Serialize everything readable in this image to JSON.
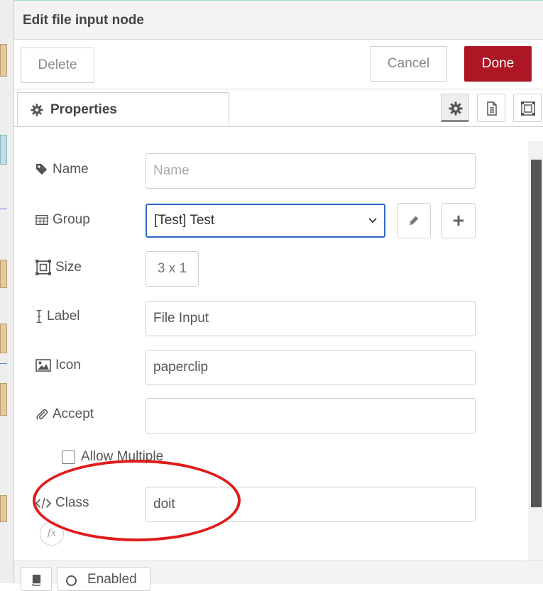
{
  "title": "Edit file input node",
  "buttons": {
    "delete": "Delete",
    "cancel": "Cancel",
    "done": "Done"
  },
  "tabs": {
    "properties": "Properties"
  },
  "fields": {
    "name": {
      "label": "Name",
      "placeholder": "Name",
      "value": ""
    },
    "group": {
      "label": "Group",
      "value": "[Test] Test"
    },
    "size": {
      "label": "Size",
      "value": "3 x 1"
    },
    "label": {
      "label": "Label",
      "value": "File Input"
    },
    "icon": {
      "label": "Icon",
      "value": "paperclip"
    },
    "accept": {
      "label": "Accept",
      "value": ""
    },
    "allow_multiple": {
      "label": "Allow Multiple",
      "checked": false
    },
    "class": {
      "label": "Class",
      "value": "doit"
    }
  },
  "fx_label": "fx",
  "footer": {
    "enabled": "Enabled"
  },
  "colors": {
    "done": "#ad1625",
    "annotation": "#e01b1b",
    "focus": "#2d69c7"
  },
  "icons": [
    "cog-icon",
    "document-icon",
    "frame-icon",
    "tag-icon",
    "table-icon",
    "size-icon",
    "text-cursor-icon",
    "image-icon",
    "paperclip-icon",
    "code-icon",
    "pencil-icon",
    "plus-icon",
    "book-icon"
  ]
}
